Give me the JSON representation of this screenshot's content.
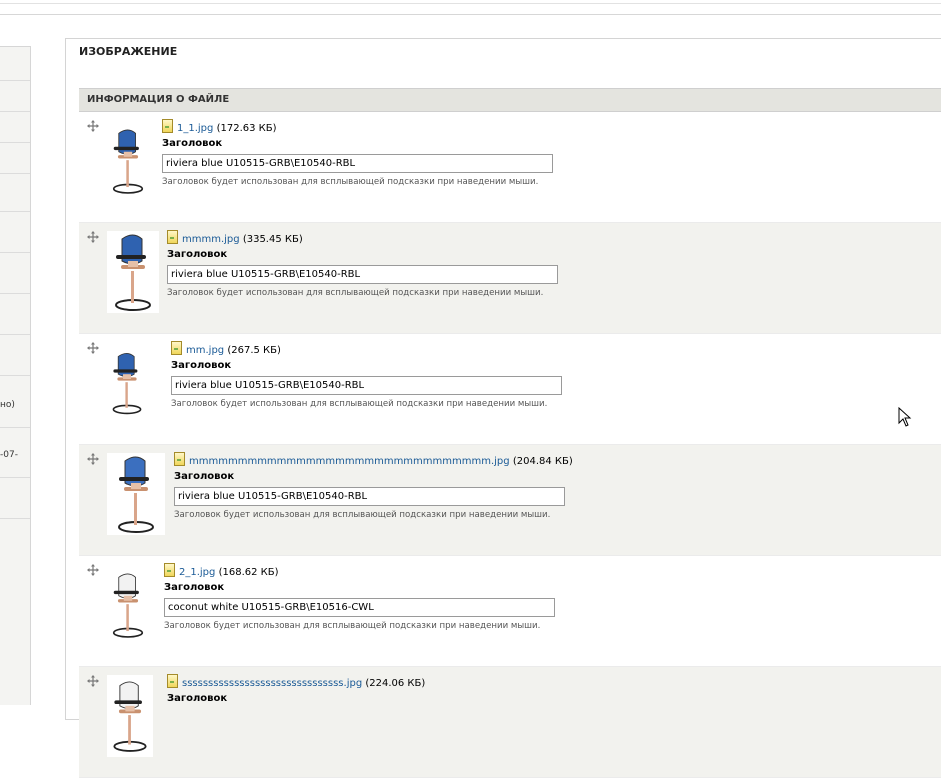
{
  "sidebar": {
    "snippets": [
      "но)",
      "-07-"
    ]
  },
  "section": {
    "title": "ИЗОБРАЖЕНИЕ",
    "table_header": "ИНФОРМАЦИЯ О ФАЙЛЕ"
  },
  "files": [
    {
      "name": "1_1.jpg",
      "size": "(172.63 КБ)",
      "label": "Заголовок",
      "title": "riviera blue U10515-GRB\\E10540-RBL",
      "hint": "Заголовок будет использован для всплывающей подсказки при наведении мыши.",
      "chair_color": "#2f62b0"
    },
    {
      "name": "mmmm.jpg",
      "size": "(335.45 КБ)",
      "label": "Заголовок",
      "title": "riviera blue U10515-GRB\\E10540-RBL",
      "hint": "Заголовок будет использован для всплывающей подсказки при наведении мыши.",
      "chair_color": "#2f62b0"
    },
    {
      "name": "mm.jpg",
      "size": "(267.5 КБ)",
      "label": "Заголовок",
      "title": "riviera blue U10515-GRB\\E10540-RBL",
      "hint": "Заголовок будет использован для всплывающей подсказки при наведении мыши.",
      "chair_color": "#2f62b0"
    },
    {
      "name": "mmmmmmmmmmmmmmmmmmmmmmmmmmmmmmm.jpg",
      "size": "(204.84 КБ)",
      "label": "Заголовок",
      "title": "riviera blue U10515-GRB\\E10540-RBL",
      "hint": "Заголовок будет использован для всплывающей подсказки при наведении мыши.",
      "chair_color": "#3b6fbf"
    },
    {
      "name": "2_1.jpg",
      "size": "(168.62 КБ)",
      "label": "Заголовок",
      "title": "coconut white U10515-GRB\\E10516-CWL",
      "hint": "Заголовок будет использован для всплывающей подсказки при наведении мыши.",
      "chair_color": "#f2f2f2"
    },
    {
      "name": "sssssssssssssssssssssssssssssss.jpg",
      "size": "(224.06 КБ)",
      "label": "Заголовок",
      "title": "",
      "hint": "",
      "chair_color": "#f2f2f2"
    }
  ],
  "colors": {
    "link": "#1a5a96",
    "header_bg": "#e4e4df",
    "alt_row": "#f2f2ee"
  },
  "icons": {
    "drag": "move-arrows-icon",
    "file": "image-file-icon",
    "cursor": "mouse-pointer-icon"
  }
}
